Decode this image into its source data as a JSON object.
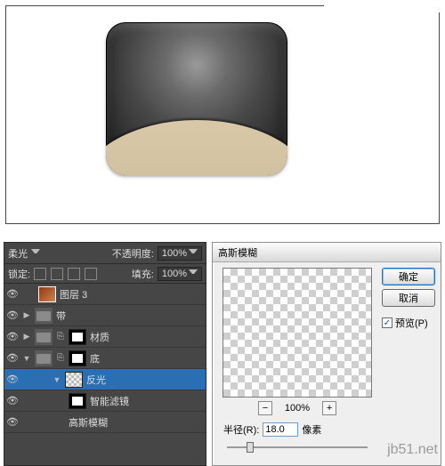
{
  "canvas": {
    "object": "wallet-icon"
  },
  "layers_panel": {
    "blend_mode": "柔光",
    "opacity_label": "不透明度:",
    "opacity_value": "100%",
    "lock_label": "锁定:",
    "fill_label": "填充:",
    "fill_value": "100%",
    "rows": [
      {
        "name": "图层 3",
        "kind": "image",
        "visible": true
      },
      {
        "name": "带",
        "kind": "folder",
        "visible": true
      },
      {
        "name": "材质",
        "kind": "folder_mask",
        "visible": true
      },
      {
        "name": "底",
        "kind": "folder_mask",
        "visible": true
      },
      {
        "name": "反光",
        "kind": "trans",
        "visible": true,
        "selected": true
      },
      {
        "name": "智能滤镜",
        "kind": "mask",
        "visible": true
      },
      {
        "name": "高斯模糊",
        "kind": "filter",
        "visible": true
      }
    ]
  },
  "dialog": {
    "title": "高斯模糊",
    "ok": "确定",
    "cancel": "取消",
    "preview_label": "预览(P)",
    "preview_checked": true,
    "zoom_level": "100%",
    "minus": "−",
    "plus": "+",
    "radius_label": "半径(R):",
    "radius_value": "18.0",
    "unit": "像素"
  },
  "watermark": "jb51.net"
}
